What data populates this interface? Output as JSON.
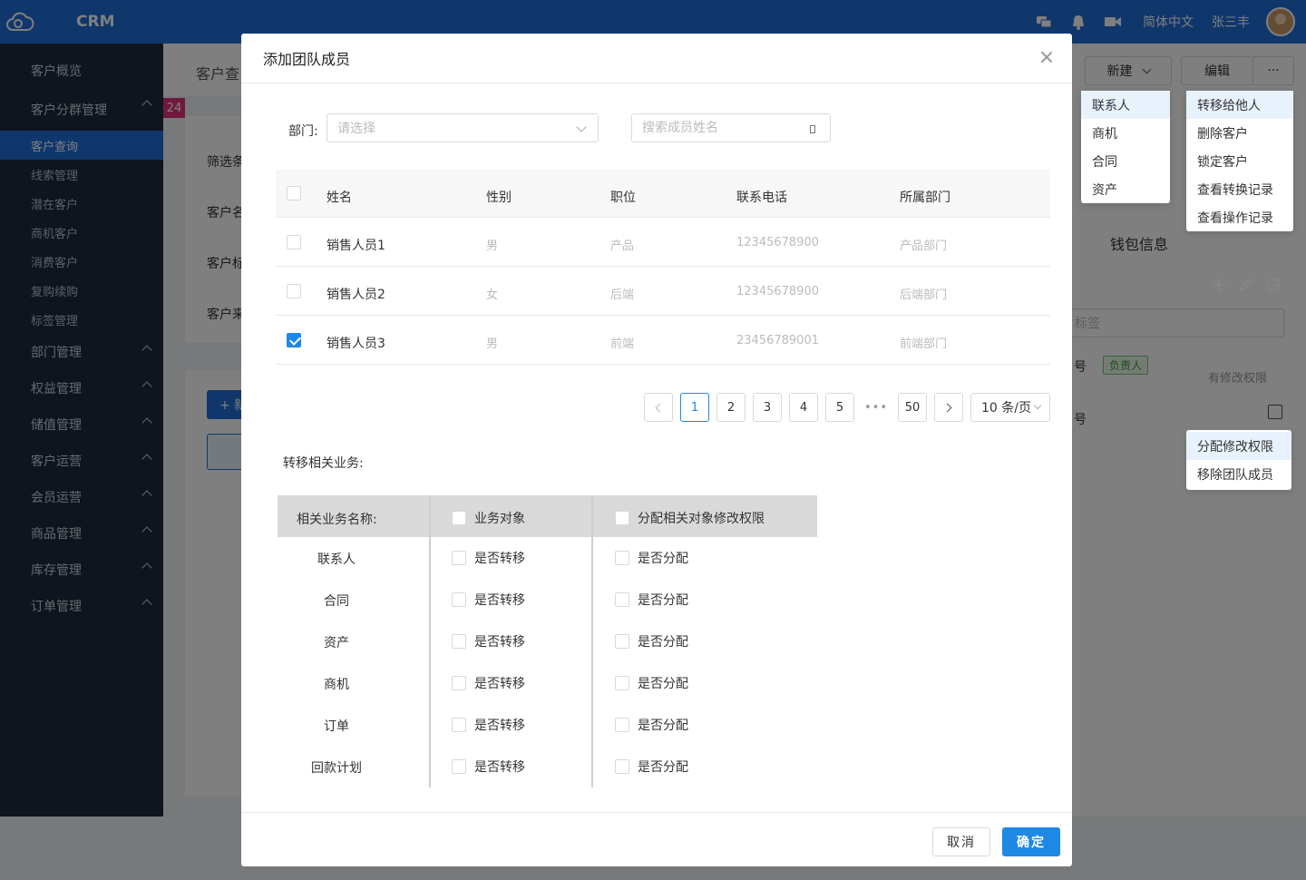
{
  "app": {
    "logo_label": "CRM",
    "language": "简体中文",
    "user": "张三丰"
  },
  "sidebar": {
    "items": [
      {
        "label": "客户概览"
      },
      {
        "label": "客户分群管理"
      },
      {
        "label": "客户查询"
      },
      {
        "label": "线索管理"
      },
      {
        "label": "潜在客户"
      },
      {
        "label": "商机客户"
      },
      {
        "label": "消费客户"
      },
      {
        "label": "复购续购"
      },
      {
        "label": "标签管理"
      },
      {
        "label": "部门管理"
      },
      {
        "label": "权益管理"
      },
      {
        "label": "储值管理"
      },
      {
        "label": "客户运营"
      },
      {
        "label": "会员运营"
      },
      {
        "label": "商品管理"
      },
      {
        "label": "库存管理"
      },
      {
        "label": "订单管理"
      }
    ]
  },
  "background": {
    "page_title": "客户查",
    "badge": "24",
    "filter_labels": [
      "筛选条",
      "客户名",
      "客户标",
      "客户来"
    ],
    "add_button": "+ 新",
    "new_button": "新建",
    "edit_button": "编辑",
    "more_button": "···",
    "new_menu": [
      "联系人",
      "商机",
      "合同",
      "资产"
    ],
    "more_menu": [
      "转移给他人",
      "删除客户",
      "锁定客户",
      "查看转换记录",
      "查看操作记录"
    ],
    "wallet_title": "钱包信息",
    "tag_placeholder": "标签",
    "owner_badge": "负责人",
    "permission_text": "有修改权限",
    "row_label_1": "号",
    "row_label_2": "号",
    "member_menu": [
      "分配修改权限",
      "移除团队成员"
    ]
  },
  "modal": {
    "title": "添加团队成员",
    "department_label": "部门:",
    "department_placeholder": "请选择",
    "search_placeholder": "搜索成员姓名",
    "table": {
      "columns": [
        "姓名",
        "性别",
        "职位",
        "联系电话",
        "所属部门"
      ],
      "rows": [
        {
          "checked": false,
          "name": "销售人员1",
          "gender": "男",
          "position": "产品",
          "phone": "12345678900",
          "dept": "产品部门"
        },
        {
          "checked": false,
          "name": "销售人员2",
          "gender": "女",
          "position": "后端",
          "phone": "12345678900",
          "dept": "后端部门"
        },
        {
          "checked": true,
          "name": "销售人员3",
          "gender": "男",
          "position": "前端",
          "phone": "23456789001",
          "dept": "前端部门"
        }
      ]
    },
    "pagination": {
      "pages": [
        "1",
        "2",
        "3",
        "4",
        "5"
      ],
      "ellipsis": "•••",
      "last": "50",
      "current": "1",
      "page_size": "10 条/页"
    },
    "transfer_label": "转移相关业务:",
    "transfer_table": {
      "header": {
        "name": "相关业务名称:",
        "col1": "业务对象",
        "col2": "分配相关对象修改权限"
      },
      "rows": [
        {
          "name": "联系人",
          "col1": "是否转移",
          "col2": "是否分配"
        },
        {
          "name": "合同",
          "col1": "是否转移",
          "col2": "是否分配"
        },
        {
          "name": "资产",
          "col1": "是否转移",
          "col2": "是否分配"
        },
        {
          "name": "商机",
          "col1": "是否转移",
          "col2": "是否分配"
        },
        {
          "name": "订单",
          "col1": "是否转移",
          "col2": "是否分配"
        },
        {
          "name": "回款计划",
          "col1": "是否转移",
          "col2": "是否分配"
        }
      ]
    },
    "cancel_label": "取消",
    "ok_label": "确定"
  },
  "colors": {
    "primary": "#1e6fd9",
    "accent": "#1e88e5",
    "sidebar": "#1f2a3d",
    "badge": "#e0317c",
    "owner_badge_bg": "#e6f6e6"
  }
}
